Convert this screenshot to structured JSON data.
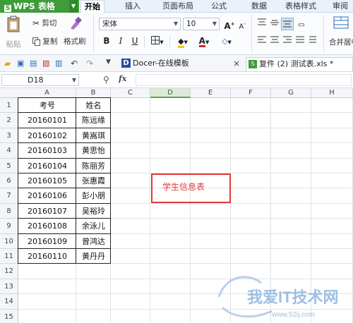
{
  "app": {
    "name": "WPS 表格"
  },
  "menu_tabs": [
    "开始",
    "插入",
    "页面布局",
    "公式",
    "数据",
    "表格样式",
    "审阅"
  ],
  "active_tab": "开始",
  "ribbon": {
    "paste": "粘贴",
    "cut": "剪切",
    "copy": "复制",
    "format_painter": "格式刷",
    "font_name": "宋体",
    "font_size": "10",
    "bold": "B",
    "italic": "I",
    "underline": "U",
    "merge_center": "合并居中",
    "increase_font": "A",
    "decrease_font": "A"
  },
  "quickbar": {
    "doc_tab_1": "Docer-在线模板",
    "doc_tab_2": "复件 (2) 测试表.xls *",
    "close": "×"
  },
  "formula_bar": {
    "name_box": "D18",
    "fx": "fx",
    "formula": ""
  },
  "columns": [
    "A",
    "B",
    "C",
    "D",
    "E",
    "F",
    "G",
    "H"
  ],
  "selected_column": "D",
  "rows": [
    "1",
    "2",
    "3",
    "4",
    "5",
    "6",
    "7",
    "8",
    "9",
    "10",
    "11",
    "12",
    "13",
    "14",
    "15"
  ],
  "table": {
    "headers": [
      "考号",
      "姓名"
    ],
    "records": [
      [
        "20160101",
        "陈远缘"
      ],
      [
        "20160102",
        "黄嵩琪"
      ],
      [
        "20160103",
        "黄思怡"
      ],
      [
        "20160104",
        "陈丽芳"
      ],
      [
        "20160105",
        "张惠霞"
      ],
      [
        "20160106",
        "彭小朋"
      ],
      [
        "20160107",
        "吴裕玲"
      ],
      [
        "20160108",
        "余泳儿"
      ],
      [
        "20160109",
        "曾鸿达"
      ],
      [
        "20160110",
        "黄丹丹"
      ]
    ]
  },
  "annotation": {
    "text": "学生信息表",
    "color": "#e23a3a"
  },
  "watermark": {
    "text": "我爱IT技术网",
    "url": "www.52ij.com"
  },
  "colors": {
    "app_green": "#3f9c3a",
    "accent_blue": "#2a6ebb"
  }
}
